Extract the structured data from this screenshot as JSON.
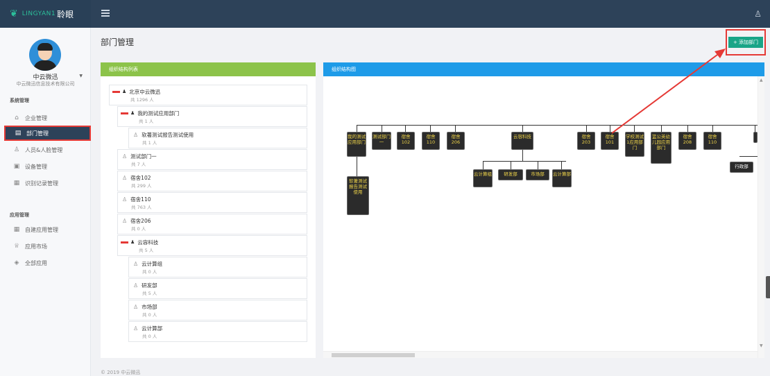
{
  "topbar": {
    "logo_mark": "❦",
    "logo_en": "LINGYAN1",
    "logo_cn": "聆眼",
    "menu_icon": "hamburger-icon",
    "user_icon": "user-icon"
  },
  "sidebar": {
    "user_name": "中云微迅",
    "company": "中云微迅信息技术有限公司",
    "section_system": "系统管理",
    "section_apps": "应用管理",
    "items": [
      {
        "label": "企业管理",
        "icon": "home-icon",
        "glyph": "⌂"
      },
      {
        "label": "部门管理",
        "icon": "department-icon",
        "glyph": "▤",
        "active": true
      },
      {
        "label": "人员&人脸管理",
        "icon": "person-icon",
        "glyph": "♙"
      },
      {
        "label": "设备管理",
        "icon": "device-icon",
        "glyph": "▣"
      },
      {
        "label": "识别记录管理",
        "icon": "record-icon",
        "glyph": "▦"
      },
      {
        "label": "自建应用管理",
        "icon": "grid-icon",
        "glyph": "▦"
      },
      {
        "label": "应用市场",
        "icon": "market-icon",
        "glyph": "♕"
      },
      {
        "label": "全部应用",
        "icon": "cube-icon",
        "glyph": "◈"
      }
    ]
  },
  "page": {
    "title": "部门管理",
    "add_button": "+ 添加部门"
  },
  "org_list": {
    "header": "组织结构列表",
    "nodes": [
      {
        "name": "北京中云微迅",
        "count": "共 1296 人",
        "type": "group"
      },
      {
        "name": "我的测试应用部门",
        "count": "共 1 人",
        "type": "group"
      },
      {
        "name": "软著测试报告测试使用",
        "count": "共 1 人",
        "type": "user"
      },
      {
        "name": "测试部门一",
        "count": "共 7 人",
        "type": "user"
      },
      {
        "name": "宿舍102",
        "count": "共 299 人",
        "type": "user"
      },
      {
        "name": "宿舍110",
        "count": "共 763 人",
        "type": "user"
      },
      {
        "name": "宿舍206",
        "count": "共 0 人",
        "type": "user"
      },
      {
        "name": "云容科技",
        "count": "共 5 人",
        "type": "group"
      },
      {
        "name": "云计算组",
        "count": "共 0 人",
        "type": "user"
      },
      {
        "name": "研发部",
        "count": "共 5 人",
        "type": "user"
      },
      {
        "name": "市场部",
        "count": "共 0 人",
        "type": "user"
      },
      {
        "name": "云计算部",
        "count": "共 0 人",
        "type": "user"
      }
    ]
  },
  "org_chart": {
    "header": "组织结构图",
    "level1": [
      "我的测试应用部门",
      "测试部门一",
      "宿舍102",
      "宿舍110",
      "宿舍206",
      "云容科技",
      "宿舍203",
      "宿舍101",
      "学校测试1应用部门",
      "篮公英幼儿园应用部门",
      "宿舍208",
      "宿舍110"
    ],
    "child_of_first": "软著测试报告测试使用",
    "children_of_yunrong": [
      "云计算组",
      "研发部",
      "市场部",
      "云计算部"
    ],
    "edge_box": "行政部"
  },
  "footer": {
    "copyright": "© 2019 中云微迅"
  }
}
